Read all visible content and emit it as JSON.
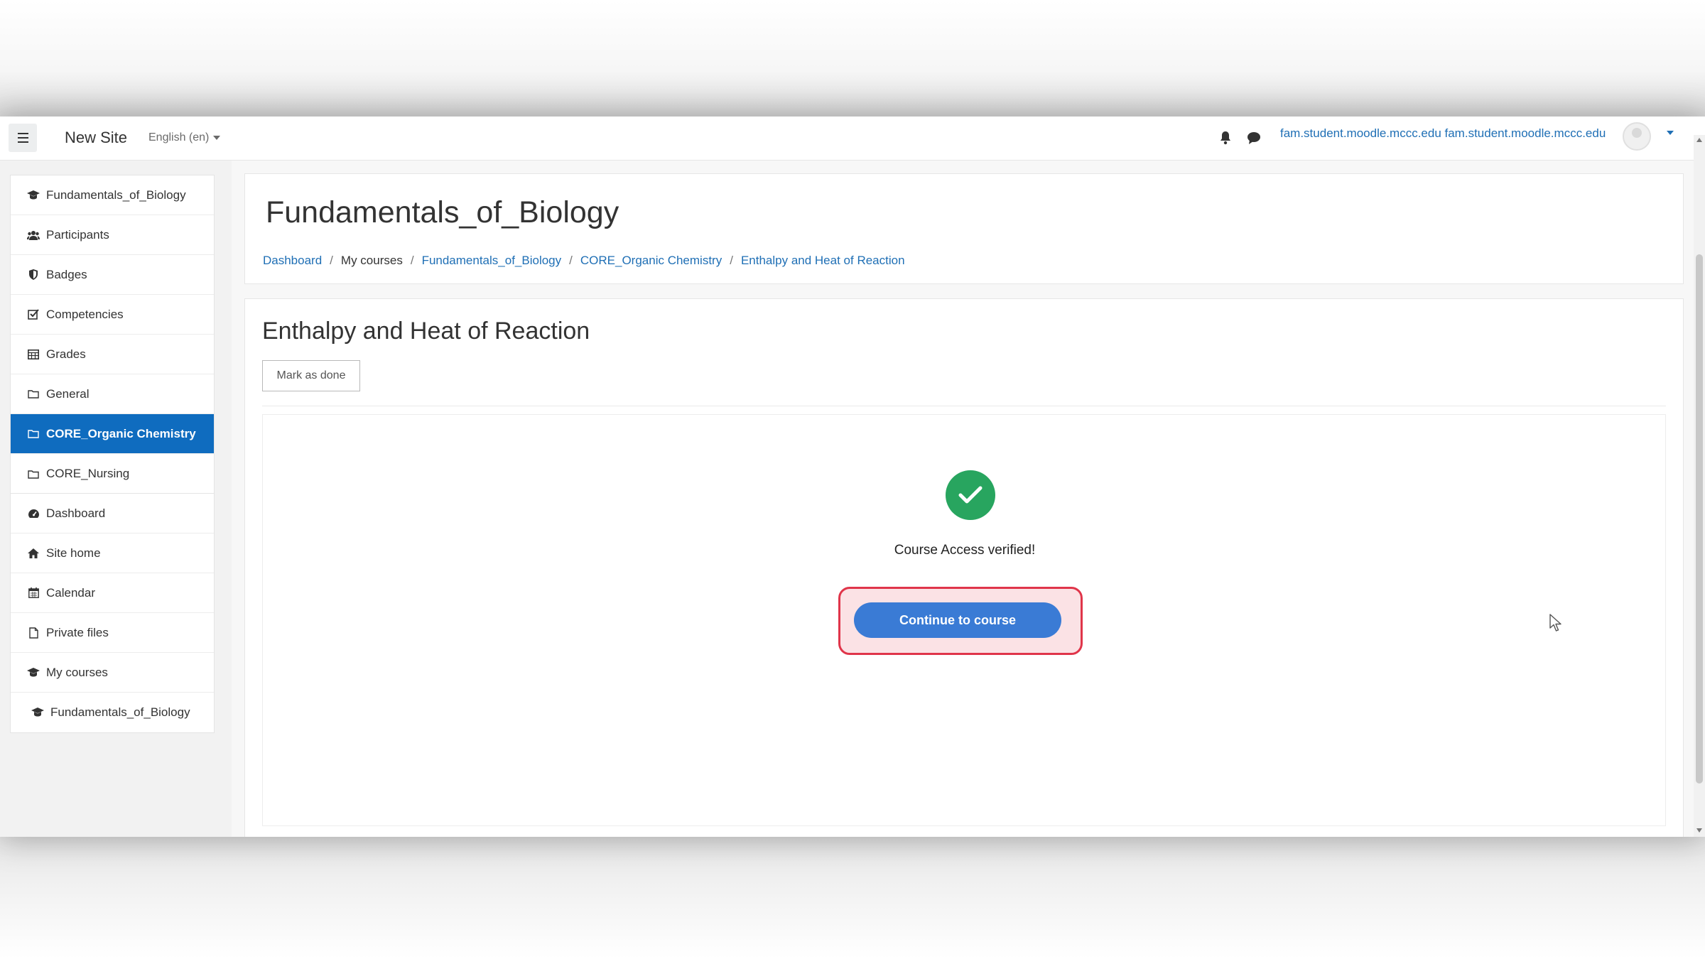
{
  "navbar": {
    "site_name": "New Site",
    "language": "English (en)",
    "user_name": "fam.student.moodle.mccc.edu fam.student.moodle.mccc.edu",
    "icons": [
      "menu-icon",
      "bell-icon",
      "chat-icon",
      "avatar",
      "chevron-down-icon"
    ]
  },
  "sidebar": {
    "course_items": [
      {
        "label": "Fundamentals_of_Biology",
        "icon": "graduation-cap-icon"
      },
      {
        "label": "Participants",
        "icon": "users-icon"
      },
      {
        "label": "Badges",
        "icon": "shield-icon"
      },
      {
        "label": "Competencies",
        "icon": "check-square-icon"
      },
      {
        "label": "Grades",
        "icon": "table-icon"
      },
      {
        "label": "General",
        "icon": "folder-icon"
      },
      {
        "label": "CORE_Organic Chemistry",
        "icon": "folder-icon",
        "active": true
      },
      {
        "label": "CORE_Nursing",
        "icon": "folder-icon"
      }
    ],
    "site_items": [
      {
        "label": "Dashboard",
        "icon": "tachometer-icon"
      },
      {
        "label": "Site home",
        "icon": "home-icon"
      },
      {
        "label": "Calendar",
        "icon": "calendar-icon"
      },
      {
        "label": "Private files",
        "icon": "file-icon"
      },
      {
        "label": "My courses",
        "icon": "graduation-cap-icon"
      },
      {
        "label": "Fundamentals_of_Biology",
        "icon": "graduation-cap-icon"
      }
    ]
  },
  "header": {
    "course_title": "Fundamentals_of_Biology",
    "breadcrumb": [
      "Dashboard",
      "My courses",
      "Fundamentals_of_Biology",
      "CORE_Organic Chemistry",
      "Enthalpy and Heat of Reaction"
    ]
  },
  "content": {
    "activity_title": "Enthalpy and Heat of Reaction",
    "mark_done_label": "Mark as done",
    "verified_text": "Course Access verified!",
    "continue_label": "Continue to course"
  },
  "colors": {
    "primary": "#0f6cbf",
    "link": "#1f6fb5",
    "success": "#28a55f",
    "button": "#3a7bd5",
    "highlight": "#e0354a"
  }
}
